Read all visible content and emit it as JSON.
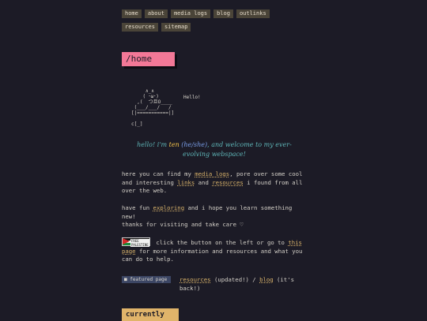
{
  "nav": [
    "home",
    "about",
    "media logs",
    "blog",
    "outlinks",
    "resources",
    "sitemap"
  ],
  "title": "/home",
  "ascii_art": "     ∧_∧\n    ( ･ω･)\n  ,(  つ旦O____\n (___/___/   /\n[|===========|]\n\nc[_]",
  "hello_label": "Hello!",
  "greeting": {
    "pre": "hello! i'm ",
    "name": "ten",
    "pronouns": "(he/she)",
    "post": ", and welcome to my ever-evolving webspace!"
  },
  "intro": {
    "t1": "here you can find my ",
    "link1": "media logs",
    "t2": ", pore over some cool and interesting ",
    "link2": "links",
    "t3": " and ",
    "link3": "resources",
    "t4": " i found from all over the web."
  },
  "explore": {
    "t1": "have fun ",
    "link": "exploring",
    "t2": " and i hope you learn something new!"
  },
  "thanks": "thanks for visiting and take care ♡",
  "palestine": {
    "badge": "FREE PALESTINE",
    "t1": " click the button on the left or go to ",
    "link": "this page",
    "t2": " for more information and resources and what you can do to help."
  },
  "featured": {
    "label": "■ featured page",
    "link1": "resources",
    "t1": " (updated!) / ",
    "link2": "blog",
    "t2": " (it's back!)"
  },
  "currently": "currently"
}
